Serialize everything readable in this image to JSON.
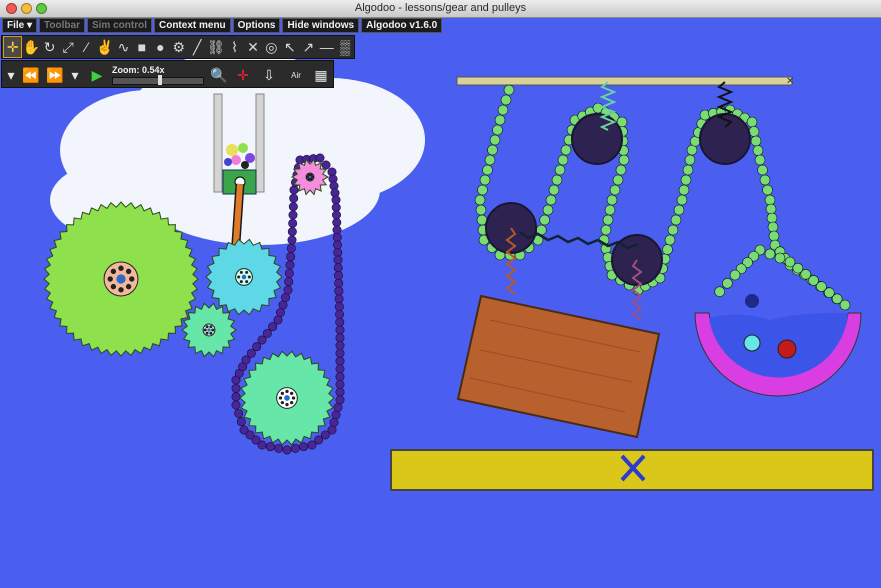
{
  "window": {
    "title": "Algodoo - lessons/gear and pulleys"
  },
  "menubar": {
    "file": "File ▾",
    "toolbar": "Toolbar",
    "sim_control": "Sim control",
    "context_menu": "Context menu",
    "options": "Options",
    "hide_windows": "Hide windows",
    "version": "Algodoo v1.6.0"
  },
  "tools": [
    {
      "name": "move-tool-icon",
      "glyph": "✛"
    },
    {
      "name": "drag-tool-icon",
      "glyph": "✋"
    },
    {
      "name": "rotate-tool-icon",
      "glyph": "↻"
    },
    {
      "name": "scale-tool-icon",
      "glyph": "⤢"
    },
    {
      "name": "knife-tool-icon",
      "glyph": "∕"
    },
    {
      "name": "sketch-tool-icon",
      "glyph": "✌"
    },
    {
      "name": "brush-tool-icon",
      "glyph": "∿"
    },
    {
      "name": "box-tool-icon",
      "glyph": "■"
    },
    {
      "name": "circle-tool-icon",
      "glyph": "●"
    },
    {
      "name": "gear-tool-icon",
      "glyph": "⚙"
    },
    {
      "name": "plane-tool-icon",
      "glyph": "╱"
    },
    {
      "name": "chain-tool-icon",
      "glyph": "⛓"
    },
    {
      "name": "spring-tool-icon",
      "glyph": "⌇"
    },
    {
      "name": "fixate-tool-icon",
      "glyph": "✕"
    },
    {
      "name": "axle-tool-icon",
      "glyph": "◎"
    },
    {
      "name": "thruster-tool-icon",
      "glyph": "↖"
    },
    {
      "name": "tracer-tool-icon",
      "glyph": "↗"
    },
    {
      "name": "laser-tool-icon",
      "glyph": "―"
    },
    {
      "name": "texture-tool-icon",
      "glyph": "▒"
    }
  ],
  "sim": {
    "zoom_label": "Zoom: 0.54x",
    "zoom_level": 0.54,
    "air_label": "Air"
  },
  "colors": {
    "background": "#4a5ff0",
    "gear_lime": "#8fe04d",
    "gear_mint": "#66e6a8",
    "gear_cyan": "#5ed7e7",
    "gear_pink": "#f48ddb",
    "chain_purple": "#4a2499",
    "chain_green": "#79dd72",
    "pulley_dark": "#2d2250",
    "wood": "#b8612e",
    "platform_yellow": "#dac71a",
    "bucket_magenta": "#d93ee3",
    "water": "#3c55e8"
  }
}
